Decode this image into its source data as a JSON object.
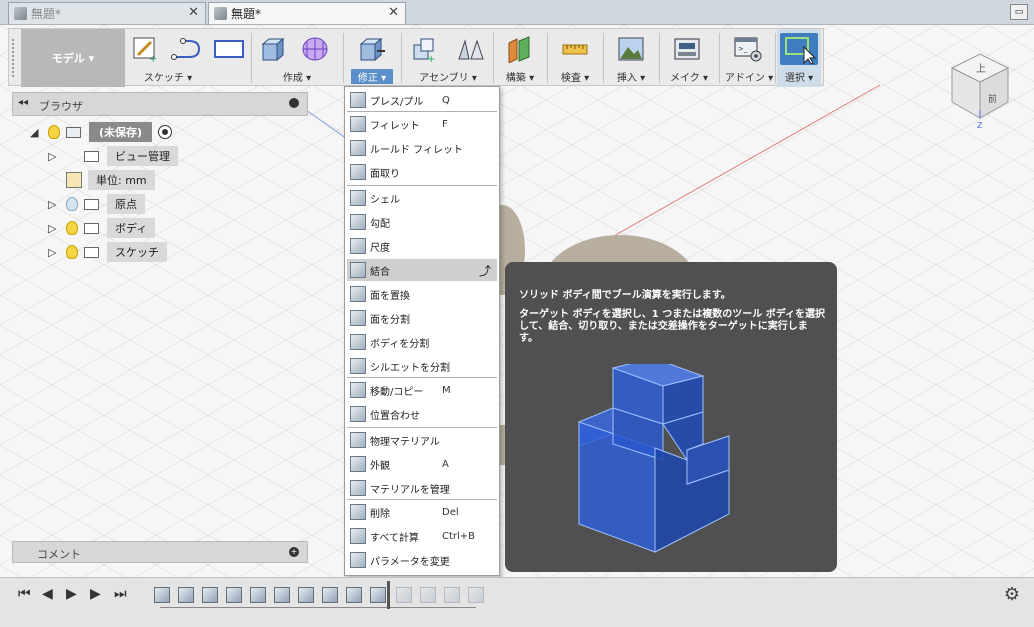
{
  "tabs": [
    {
      "label": "無題*",
      "active": false
    },
    {
      "label": "無題*",
      "active": true
    }
  ],
  "toolbar": {
    "mode": "モデル ▾",
    "groups": [
      {
        "label": "スケッチ ▾",
        "icon": "sketch-icon"
      },
      {
        "label": "作成 ▾",
        "icon": "create-icon"
      },
      {
        "label": "修正 ▾",
        "icon": "modify-icon",
        "active": true
      },
      {
        "label": "アセンブリ ▾",
        "icon": "assembly-icon"
      },
      {
        "label": "構築 ▾",
        "icon": "construct-icon"
      },
      {
        "label": "検査 ▾",
        "icon": "inspect-icon"
      },
      {
        "label": "挿入 ▾",
        "icon": "insert-icon"
      },
      {
        "label": "メイク ▾",
        "icon": "make-icon"
      },
      {
        "label": "アドイン ▾",
        "icon": "addins-icon"
      },
      {
        "label": "選択 ▾",
        "icon": "select-icon"
      }
    ]
  },
  "browser": {
    "title": "ブラウザ",
    "root": "(未保存)",
    "items": [
      {
        "label": "ビュー管理"
      },
      {
        "label": "単位: mm"
      },
      {
        "label": "原点"
      },
      {
        "label": "ボディ"
      },
      {
        "label": "スケッチ"
      }
    ]
  },
  "comment": {
    "title": "コメント"
  },
  "menu": {
    "items": [
      {
        "label": "プレス/プル",
        "shortcut": "Q"
      },
      {
        "label": "フィレット",
        "shortcut": "F"
      },
      {
        "label": "ルールド フィレット",
        "shortcut": ""
      },
      {
        "label": "面取り",
        "shortcut": ""
      },
      {
        "label": "シェル",
        "shortcut": ""
      },
      {
        "label": "勾配",
        "shortcut": ""
      },
      {
        "label": "尺度",
        "shortcut": ""
      },
      {
        "label": "結合",
        "shortcut": "",
        "highlighted": true
      },
      {
        "label": "面を置換",
        "shortcut": ""
      },
      {
        "label": "面を分割",
        "shortcut": ""
      },
      {
        "label": "ボディを分割",
        "shortcut": ""
      },
      {
        "label": "シルエットを分割",
        "shortcut": ""
      },
      {
        "label": "移動/コピー",
        "shortcut": "M"
      },
      {
        "label": "位置合わせ",
        "shortcut": ""
      },
      {
        "label": "物理マテリアル",
        "shortcut": ""
      },
      {
        "label": "外観",
        "shortcut": "A"
      },
      {
        "label": "マテリアルを管理",
        "shortcut": ""
      },
      {
        "label": "削除",
        "shortcut": "Del"
      },
      {
        "label": "すべて計算",
        "shortcut": "Ctrl+B"
      },
      {
        "label": "パラメータを変更",
        "shortcut": ""
      }
    ]
  },
  "tooltip": {
    "title": "ソリッド ボディ間でブール演算を実行します。",
    "body": "ターゲット ボディを選択し、1 つまたは複数のツール ボディを選択して、結合、切り取り、または交差操作をターゲットに実行します。"
  },
  "viewcube": {
    "top_label": "上",
    "front_label": "前",
    "axis": "Z"
  },
  "colors": {
    "accent": "#5b8fc9",
    "body_blue": "#2f5fd6"
  }
}
